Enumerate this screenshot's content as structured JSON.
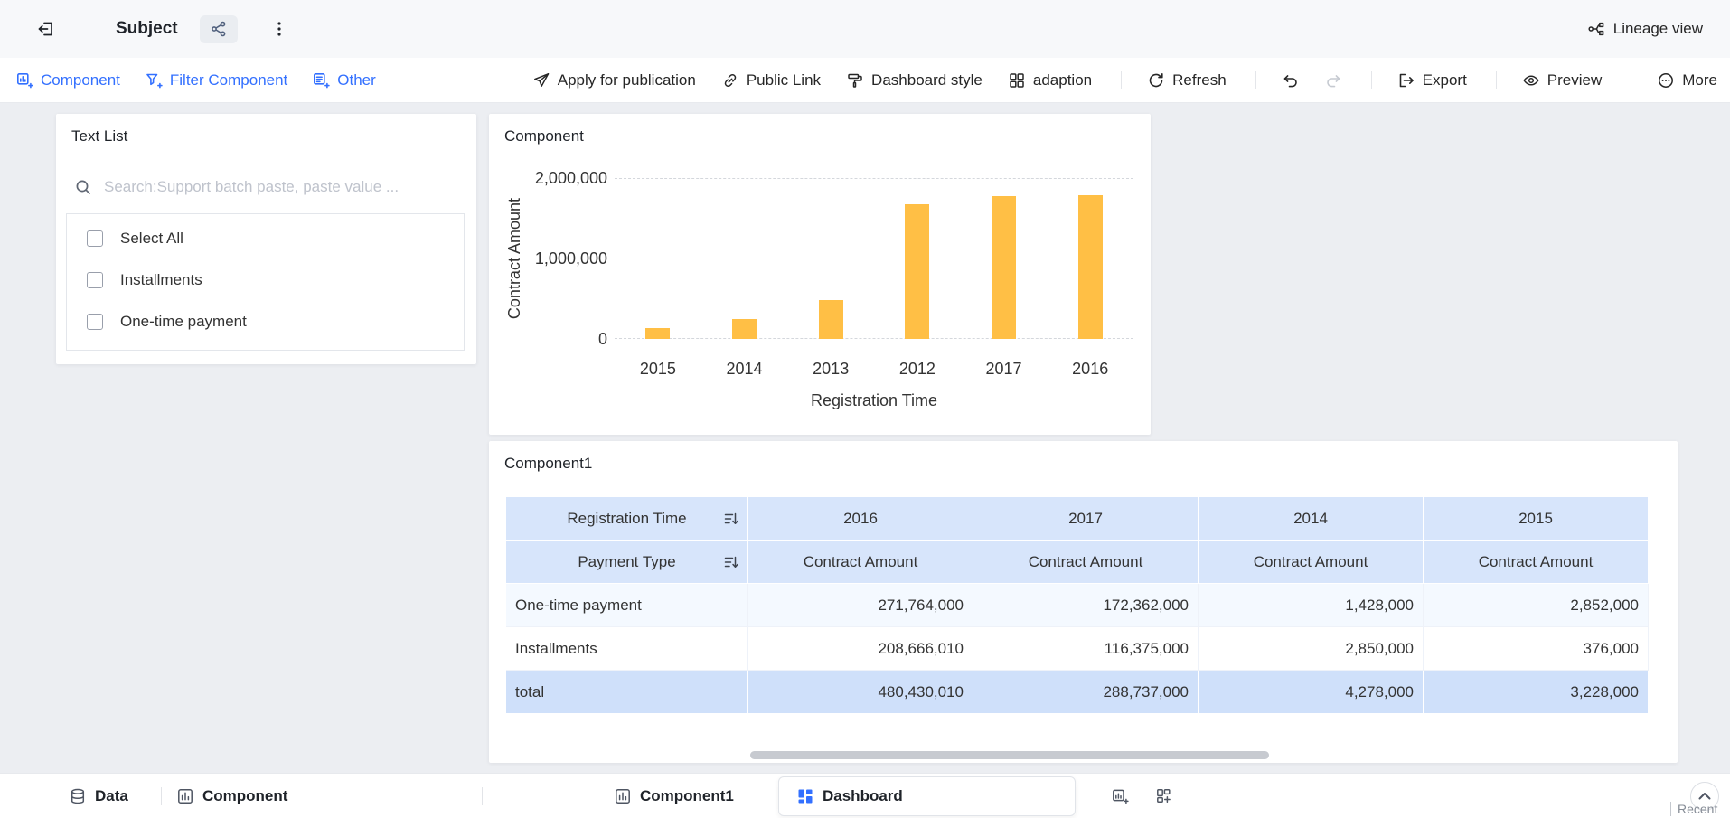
{
  "topbar": {
    "title": "Subject",
    "lineage_label": "Lineage view"
  },
  "toolbar": {
    "component": "Component",
    "filter_component": "Filter Component",
    "other": "Other",
    "apply": "Apply for publication",
    "public_link": "Public Link",
    "dashboard_style": "Dashboard style",
    "adaption": "adaption",
    "refresh": "Refresh",
    "export": "Export",
    "preview": "Preview",
    "more": "More"
  },
  "filter_card": {
    "title": "Text List",
    "search_placeholder": "Search:Support batch paste, paste value ...",
    "options": [
      "Select All",
      "Installments",
      "One-time payment"
    ]
  },
  "chart_card": {
    "title": "Component"
  },
  "chart_data": {
    "type": "bar",
    "title": "Component",
    "categories": [
      "2015",
      "2014",
      "2013",
      "2012",
      "2017",
      "2016"
    ],
    "values": [
      140000,
      250000,
      480000,
      1670000,
      1770000,
      1790000
    ],
    "xlabel": "Registration Time",
    "ylabel": "Contract Amount",
    "ylim": [
      0,
      2000000
    ],
    "yticks": [
      "2,000,000",
      "1,000,000",
      "0"
    ],
    "bar_color": "#FFBF45",
    "grid": "dashed-horizontal",
    "legend": "none"
  },
  "table_card": {
    "title": "Component1",
    "header_row1": {
      "label": "Registration Time",
      "cols": [
        "2016",
        "2017",
        "2014",
        "2015"
      ]
    },
    "header_row2": {
      "label": "Payment Type",
      "cols": [
        "Contract Amount",
        "Contract Amount",
        "Contract Amount",
        "Contract Amount"
      ]
    },
    "rows": [
      {
        "label": "One-time payment",
        "values": [
          "271,764,000",
          "172,362,000",
          "1,428,000",
          "2,852,000"
        ]
      },
      {
        "label": "Installments",
        "values": [
          "208,666,010",
          "116,375,000",
          "2,850,000",
          "376,000"
        ]
      },
      {
        "label": "total",
        "values": [
          "480,430,010",
          "288,737,000",
          "4,278,000",
          "3,228,000"
        ]
      }
    ]
  },
  "bottombar": {
    "data": "Data",
    "component": "Component",
    "component1": "Component1",
    "dashboard": "Dashboard",
    "recent": "Recent"
  },
  "colors": {
    "accent_blue": "#3370FF",
    "bar_orange": "#FFBF45",
    "table_header_bg": "#D7E5FB",
    "table_total_bg": "#CFE0FA",
    "canvas_bg": "#ECEEF2"
  },
  "icons": {
    "exit": "door-arrow-left",
    "share": "share-nodes",
    "menu": "kebab-vertical",
    "lineage": "flow-branch",
    "search": "magnifier",
    "sort": "lines-arrow-down",
    "refresh": "circular-arrow",
    "undo": "arrow-curve-left",
    "redo": "arrow-curve-right",
    "export": "bracket-arrow-right",
    "preview": "eye",
    "more": "circle-ellipsis",
    "data_tab": "database",
    "component_tab": "bar-chart-square",
    "dashboard_tab": "tiles",
    "collapse": "chevron-up-circle"
  }
}
